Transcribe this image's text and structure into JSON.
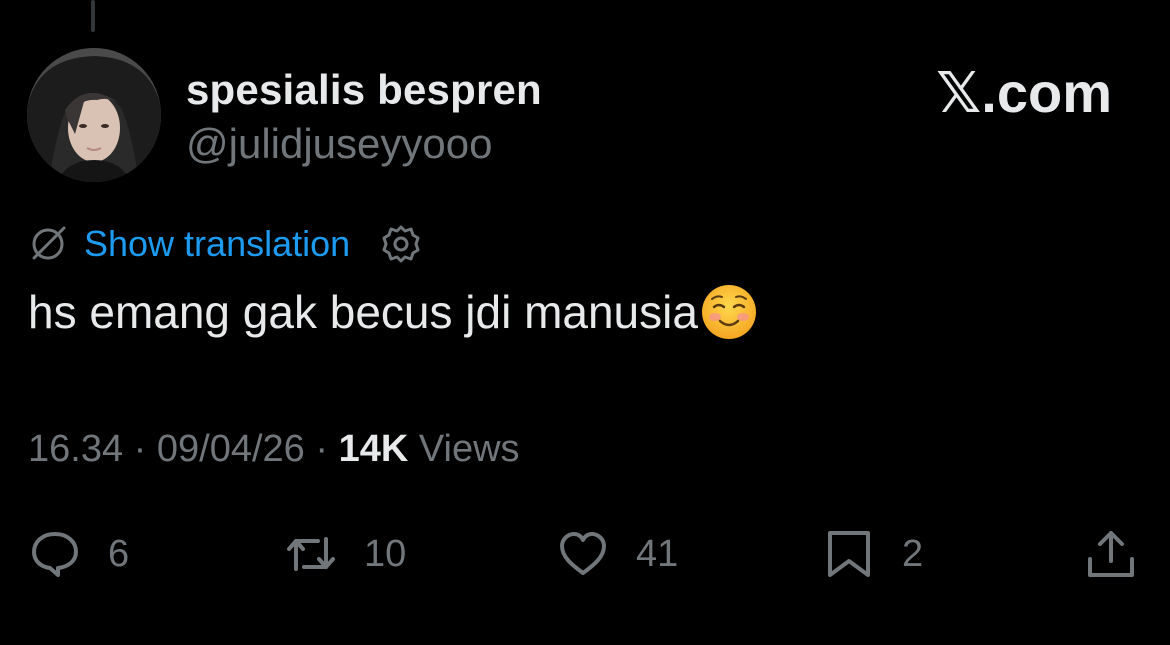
{
  "author": {
    "display_name": "spesialis bespren",
    "handle": "@julidjuseyyooo"
  },
  "brand": {
    "x_mark": "𝕏",
    "suffix": ".com"
  },
  "translation": {
    "link_label": "Show translation",
    "icon": "globe-slash-icon",
    "settings_icon": "gear-icon"
  },
  "tweet": {
    "text": "hs emang gak becus jdi manusia",
    "emoji": "smiling-face-icon"
  },
  "meta": {
    "time": "16.34",
    "date": "09/04/26",
    "separator": "·",
    "views_count": "14K",
    "views_label": "Views"
  },
  "actions": {
    "replies": "6",
    "reposts": "10",
    "likes": "41",
    "bookmarks": "2"
  },
  "colors": {
    "background": "#000000",
    "primary_text": "#e7e9ea",
    "secondary_text": "#71767b",
    "link": "#1d9bf0"
  }
}
